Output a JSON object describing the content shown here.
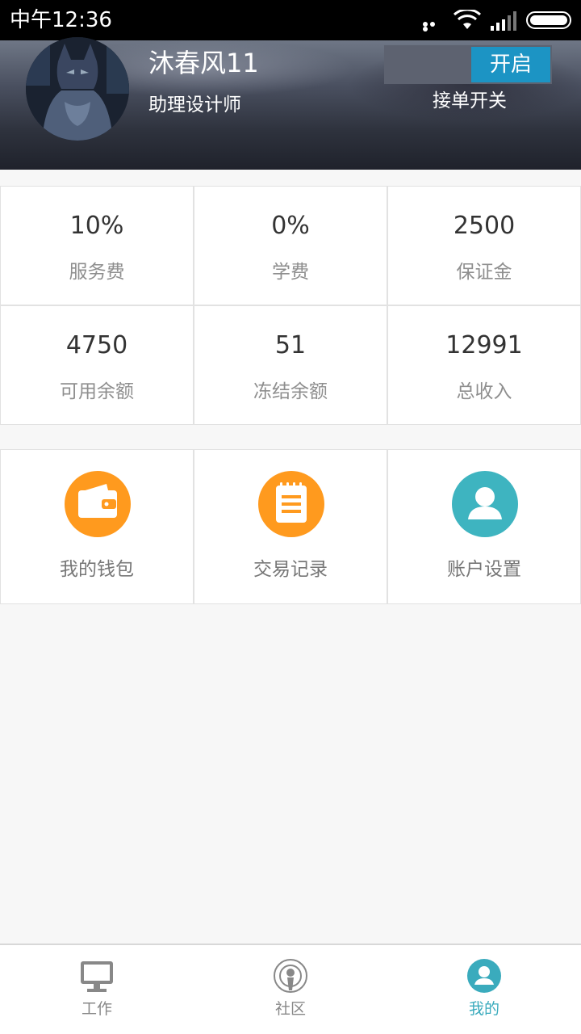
{
  "status_bar": {
    "time": "中午12:36"
  },
  "profile": {
    "name": "沐春风11",
    "role": "助理设计师",
    "order_toggle_state": "开启",
    "order_toggle_caption": "接单开关"
  },
  "stats": [
    {
      "value": "10%",
      "label": "服务费"
    },
    {
      "value": "0%",
      "label": "学费"
    },
    {
      "value": "2500",
      "label": "保证金"
    },
    {
      "value": "4750",
      "label": "可用余额"
    },
    {
      "value": "51",
      "label": "冻结余额"
    },
    {
      "value": "12991",
      "label": "总收入"
    }
  ],
  "menu": [
    {
      "label": "我的钱包",
      "icon": "wallet-icon",
      "color": "#ff9a1e"
    },
    {
      "label": "交易记录",
      "icon": "notepad-icon",
      "color": "#ff9a1e"
    },
    {
      "label": "账户设置",
      "icon": "user-icon",
      "color": "#3eb4c0"
    }
  ],
  "tabs": [
    {
      "label": "工作",
      "icon": "monitor-icon",
      "active": false
    },
    {
      "label": "社区",
      "icon": "broadcast-icon",
      "active": false
    },
    {
      "label": "我的",
      "icon": "user-icon",
      "active": true
    }
  ],
  "colors": {
    "accent": "#3aabbd",
    "toggle_on": "#1c94c4",
    "orange": "#ff9a1e"
  }
}
